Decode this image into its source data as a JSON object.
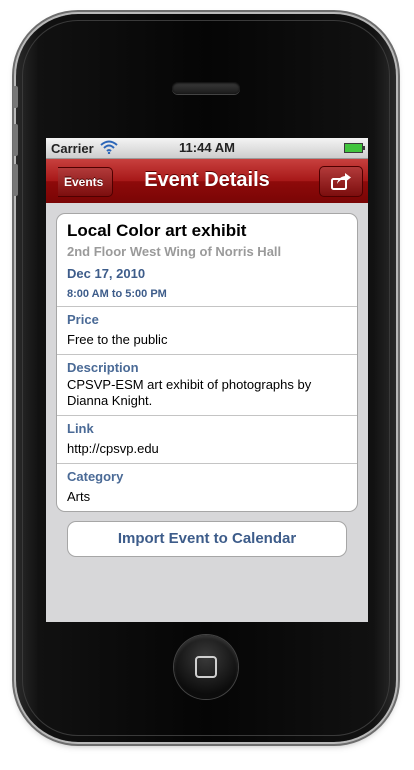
{
  "status_bar": {
    "carrier": "Carrier",
    "time": "11:44 AM"
  },
  "nav": {
    "back_label": "Events",
    "title": "Event Details"
  },
  "event": {
    "title": "Local Color art exhibit",
    "location": "2nd Floor West Wing of Norris Hall",
    "date": "Dec 17, 2010",
    "time": "8:00 AM to 5:00 PM"
  },
  "details": [
    {
      "label": "Price",
      "value": "Free to the public"
    },
    {
      "label": "Description",
      "value": "CPSVP-ESM art exhibit of photographs by Dianna Knight."
    },
    {
      "label": "Link",
      "value": "http://cpsvp.edu"
    },
    {
      "label": "Category",
      "value": "Arts"
    }
  ],
  "import_button": "Import Event to Calendar",
  "icons": {
    "wifi": "wifi-icon",
    "battery": "battery-icon",
    "share": "share-icon",
    "home": "home-button-icon"
  },
  "colors": {
    "nav_bar": "#a71818",
    "label_blue": "#4a6a96",
    "background": "#d7d7d9",
    "battery": "#41c43d"
  }
}
